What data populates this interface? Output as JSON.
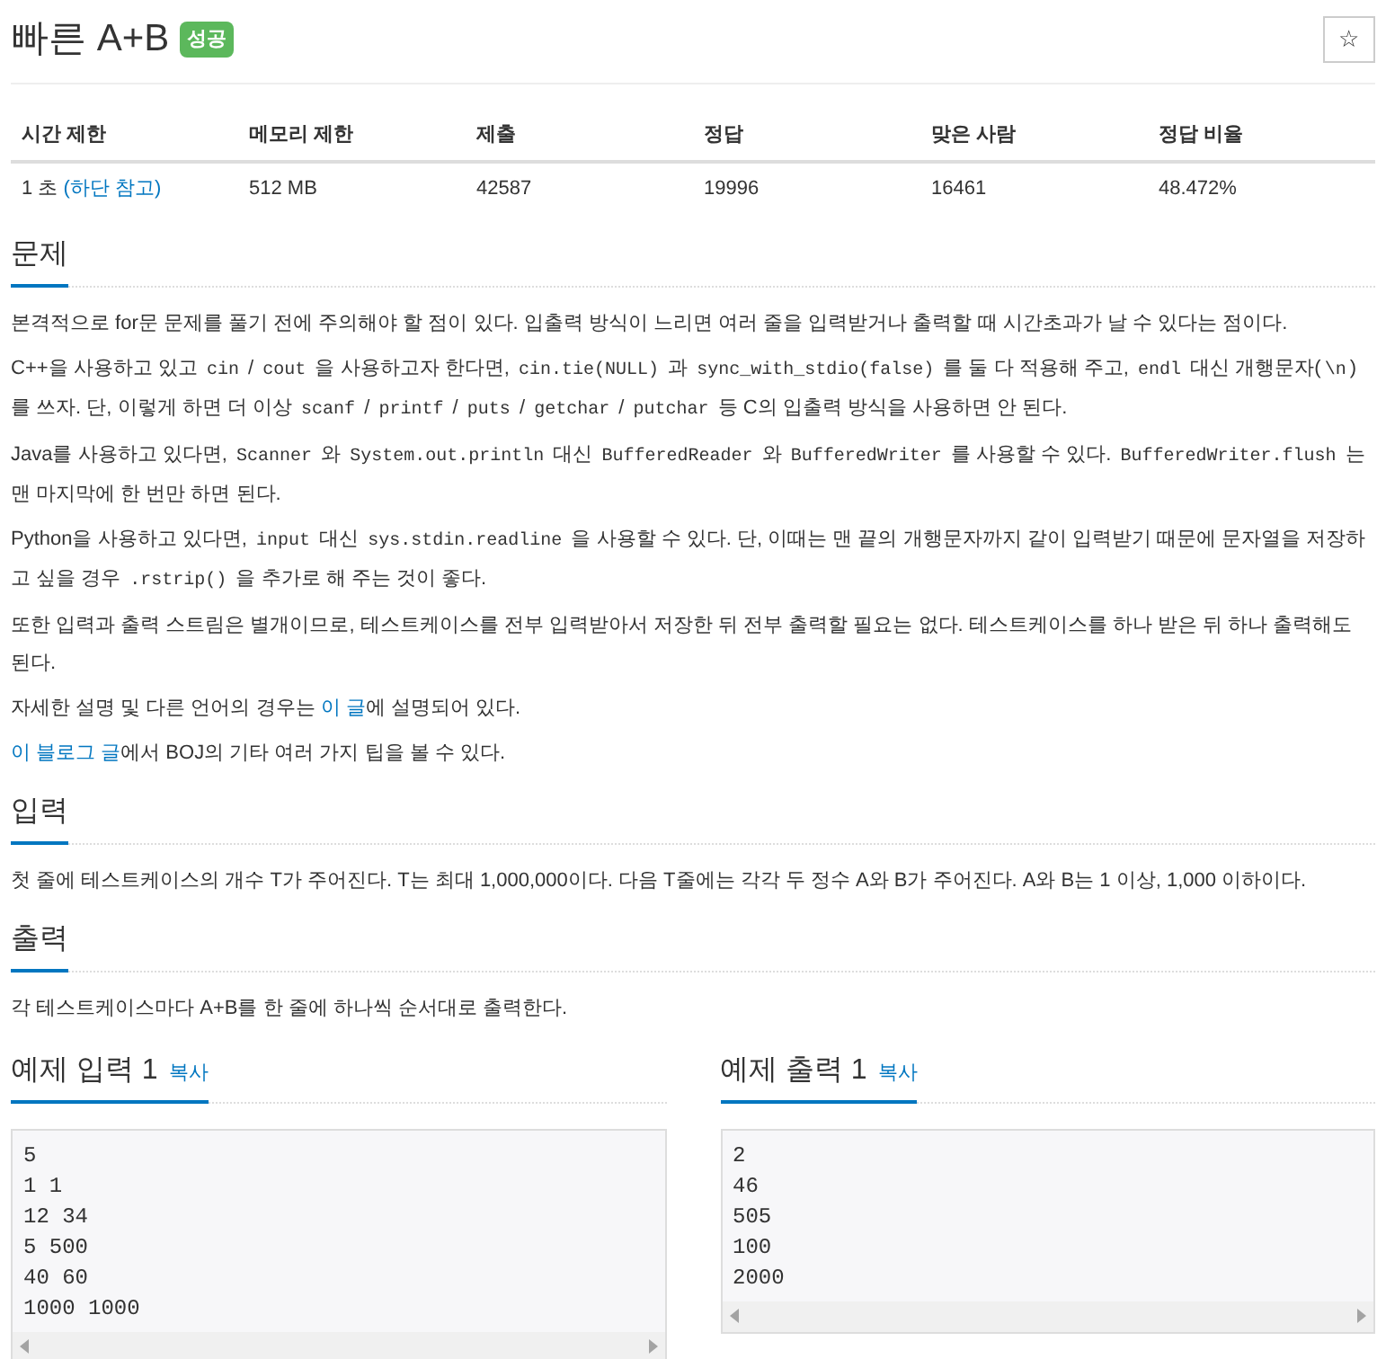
{
  "title": "빠른 A+B",
  "result_badge": "성공",
  "star_button": "☆",
  "info_table": {
    "columns": [
      "시간 제한",
      "메모리 제한",
      "제출",
      "정답",
      "맞은 사람",
      "정답 비율"
    ],
    "row": [
      {
        "kind": "mixed",
        "parts": [
          {
            "kind": "text",
            "text": "1 초 "
          },
          {
            "kind": "link",
            "text": "(하단 참고)"
          }
        ]
      },
      {
        "kind": "text",
        "text": "512 MB"
      },
      {
        "kind": "text",
        "text": "42587"
      },
      {
        "kind": "text",
        "text": "19996"
      },
      {
        "kind": "text",
        "text": "16461"
      },
      {
        "kind": "text",
        "text": "48.472%"
      }
    ]
  },
  "sections": [
    {
      "heading": "문제",
      "paragraphs": [
        [
          {
            "kind": "text",
            "text": "본격적으로 for문 문제를 풀기 전에 주의해야 할 점이 있다. 입출력 방식이 느리면 여러 줄을 입력받거나 출력할 때 시간초과가 날 수 있다는 점이다."
          }
        ],
        [
          {
            "kind": "text",
            "text": "C++을 사용하고 있고 "
          },
          {
            "kind": "code",
            "text": "cin"
          },
          {
            "kind": "text",
            "text": " / "
          },
          {
            "kind": "code",
            "text": "cout"
          },
          {
            "kind": "text",
            "text": " 을 사용하고자 한다면, "
          },
          {
            "kind": "code",
            "text": "cin.tie(NULL)"
          },
          {
            "kind": "text",
            "text": " 과 "
          },
          {
            "kind": "code",
            "text": "sync_with_stdio(false)"
          },
          {
            "kind": "text",
            "text": " 를 둘 다 적용해 주고, "
          },
          {
            "kind": "code",
            "text": "endl"
          },
          {
            "kind": "text",
            "text": " 대신 개행문자("
          },
          {
            "kind": "code",
            "text": "\\n"
          },
          {
            "kind": "text",
            "text": ")를 쓰자. 단, 이렇게 하면 더 이상 "
          },
          {
            "kind": "code",
            "text": "scanf"
          },
          {
            "kind": "text",
            "text": " / "
          },
          {
            "kind": "code",
            "text": "printf"
          },
          {
            "kind": "text",
            "text": " / "
          },
          {
            "kind": "code",
            "text": "puts"
          },
          {
            "kind": "text",
            "text": " / "
          },
          {
            "kind": "code",
            "text": "getchar"
          },
          {
            "kind": "text",
            "text": " / "
          },
          {
            "kind": "code",
            "text": "putchar"
          },
          {
            "kind": "text",
            "text": " 등 C의 입출력 방식을 사용하면 안 된다."
          }
        ],
        [
          {
            "kind": "text",
            "text": "Java를 사용하고 있다면, "
          },
          {
            "kind": "code",
            "text": "Scanner"
          },
          {
            "kind": "text",
            "text": " 와 "
          },
          {
            "kind": "code",
            "text": "System.out.println"
          },
          {
            "kind": "text",
            "text": " 대신 "
          },
          {
            "kind": "code",
            "text": "BufferedReader"
          },
          {
            "kind": "text",
            "text": " 와 "
          },
          {
            "kind": "code",
            "text": "BufferedWriter"
          },
          {
            "kind": "text",
            "text": " 를 사용할 수 있다. "
          },
          {
            "kind": "code",
            "text": "BufferedWriter.flush"
          },
          {
            "kind": "text",
            "text": " 는 맨 마지막에 한 번만 하면 된다."
          }
        ],
        [
          {
            "kind": "text",
            "text": "Python을 사용하고 있다면, "
          },
          {
            "kind": "code",
            "text": "input"
          },
          {
            "kind": "text",
            "text": " 대신 "
          },
          {
            "kind": "code",
            "text": "sys.stdin.readline"
          },
          {
            "kind": "text",
            "text": " 을 사용할 수 있다. 단, 이때는 맨 끝의 개행문자까지 같이 입력받기 때문에 문자열을 저장하고 싶을 경우 "
          },
          {
            "kind": "code",
            "text": ".rstrip()"
          },
          {
            "kind": "text",
            "text": " 을 추가로 해 주는 것이 좋다."
          }
        ],
        [
          {
            "kind": "text",
            "text": "또한 입력과 출력 스트림은 별개이므로, 테스트케이스를 전부 입력받아서 저장한 뒤 전부 출력할 필요는 없다. 테스트케이스를 하나 받은 뒤 하나 출력해도 된다."
          }
        ],
        [
          {
            "kind": "text",
            "text": "자세한 설명 및 다른 언어의 경우는 "
          },
          {
            "kind": "link",
            "text": "이 글"
          },
          {
            "kind": "text",
            "text": "에 설명되어 있다."
          }
        ],
        [
          {
            "kind": "link",
            "text": "이 블로그 글"
          },
          {
            "kind": "text",
            "text": "에서 BOJ의 기타 여러 가지 팁을 볼 수 있다."
          }
        ]
      ]
    },
    {
      "heading": "입력",
      "paragraphs": [
        [
          {
            "kind": "text",
            "text": "첫 줄에 테스트케이스의 개수 T가 주어진다. T는 최대 1,000,000이다. 다음 T줄에는 각각 두 정수 A와 B가 주어진다. A와 B는 1 이상, 1,000 이하이다."
          }
        ]
      ]
    },
    {
      "heading": "출력",
      "paragraphs": [
        [
          {
            "kind": "text",
            "text": "각 테스트케이스마다 A+B를 한 줄에 하나씩 순서대로 출력한다."
          }
        ]
      ]
    }
  ],
  "examples": [
    {
      "heading": "예제 입력 1",
      "copy": "복사",
      "lines": [
        "5",
        "1 1",
        "12 34",
        "5 500",
        "40 60",
        "1000 1000"
      ]
    },
    {
      "heading": "예제 출력 1",
      "copy": "복사",
      "lines": [
        "2",
        "46",
        "505",
        "100",
        "2000"
      ]
    }
  ]
}
